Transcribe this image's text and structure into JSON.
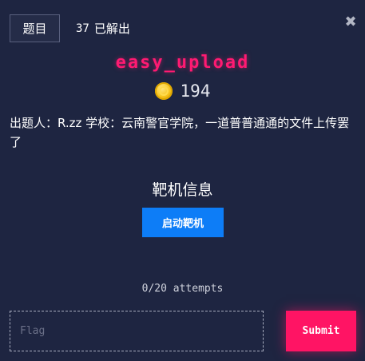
{
  "header": {
    "tab_label": "题目",
    "solve_count": "37",
    "solve_suffix": "已解出",
    "close_glyph": "✖"
  },
  "challenge": {
    "title": "easy_upload",
    "points": "194",
    "description": "出题人：R.zz 学校：云南警官学院，一道普普通通的文件上传罢了"
  },
  "target": {
    "heading": "靶机信息",
    "start_button_label": "启动靶机"
  },
  "attempts_text": "0/20 attempts",
  "flag_form": {
    "placeholder": "Flag",
    "value": "",
    "submit_label": "Submit"
  },
  "icons": {
    "coin": "coin-icon",
    "close": "close-icon"
  },
  "colors": {
    "background": "#1e2541",
    "title": "#ff1a72",
    "start_button": "#0d7df7",
    "submit_button": "#ff1464"
  }
}
